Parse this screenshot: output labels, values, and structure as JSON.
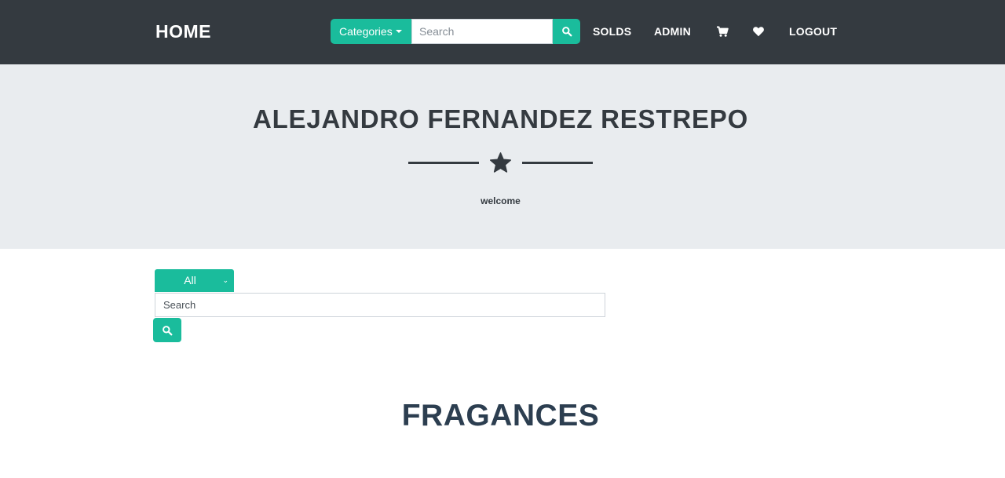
{
  "navbar": {
    "brand": "HOME",
    "categories_label": "Categories",
    "search_placeholder": "Search",
    "links": {
      "solds": "SOLDS",
      "admin": "ADMIN",
      "logout": "LOGOUT"
    },
    "icons": [
      "search-icon",
      "cart-icon",
      "heart-icon",
      "caret-down-icon"
    ]
  },
  "header": {
    "name": "ALEJANDRO FERNANDEZ RESTREPO",
    "divider_icon": "star-icon",
    "subtitle": "welcome"
  },
  "filter": {
    "selected": "All",
    "search_placeholder": "Search"
  },
  "section": {
    "title": "FRAGANCES"
  },
  "colors": {
    "navbar_bg": "#343a40",
    "accent": "#1abc9c",
    "masthead_bg": "#e9ecef",
    "heading": "#2c3e50"
  }
}
